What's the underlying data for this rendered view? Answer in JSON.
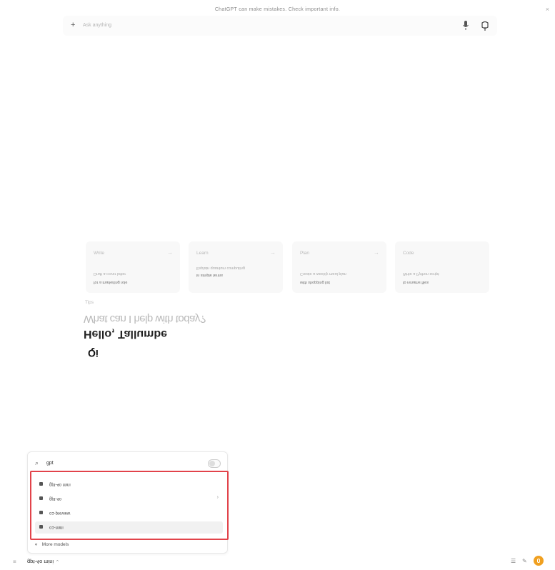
{
  "banner": {
    "text": "ChatGPT can make mistakes. Check important info.",
    "close": "×"
  },
  "composer": {
    "plus": "+",
    "placeholder": "Ask anything"
  },
  "hint": "Tips",
  "hero": {
    "logo": "Qi",
    "title": "Hello, Tallumbe",
    "subtitle": "What can I help with today?"
  },
  "cards": [
    {
      "title": "Write",
      "line1": "Draft a cover letter",
      "line2": "for a marketing role"
    },
    {
      "title": "Learn",
      "line1": "Explain quantum computing",
      "line2": "in simple terms"
    },
    {
      "title": "Plan",
      "line1": "Create a weekly meal plan",
      "line2": "with shopping list"
    },
    {
      "title": "Code",
      "line1": "Write a Python script",
      "line2": "to rename files"
    }
  ],
  "popover": {
    "search_value": "gpt",
    "models": [
      {
        "label": "gpt-4o mini",
        "active": false,
        "chevron": ""
      },
      {
        "label": "gpt-4o",
        "active": false,
        "chevron": "›"
      },
      {
        "label": "o1-preview",
        "active": false,
        "chevron": ""
      },
      {
        "label": "o1-mini",
        "active": true,
        "chevron": ""
      }
    ],
    "more_icon": "◐",
    "more_label": "More models"
  },
  "footer": {
    "left_icon": "≡",
    "model_label": "gpt-4o mini",
    "model_chevron": "⌄",
    "icons": [
      "list-icon",
      "notes-icon",
      "orange-avatar-icon"
    ]
  }
}
